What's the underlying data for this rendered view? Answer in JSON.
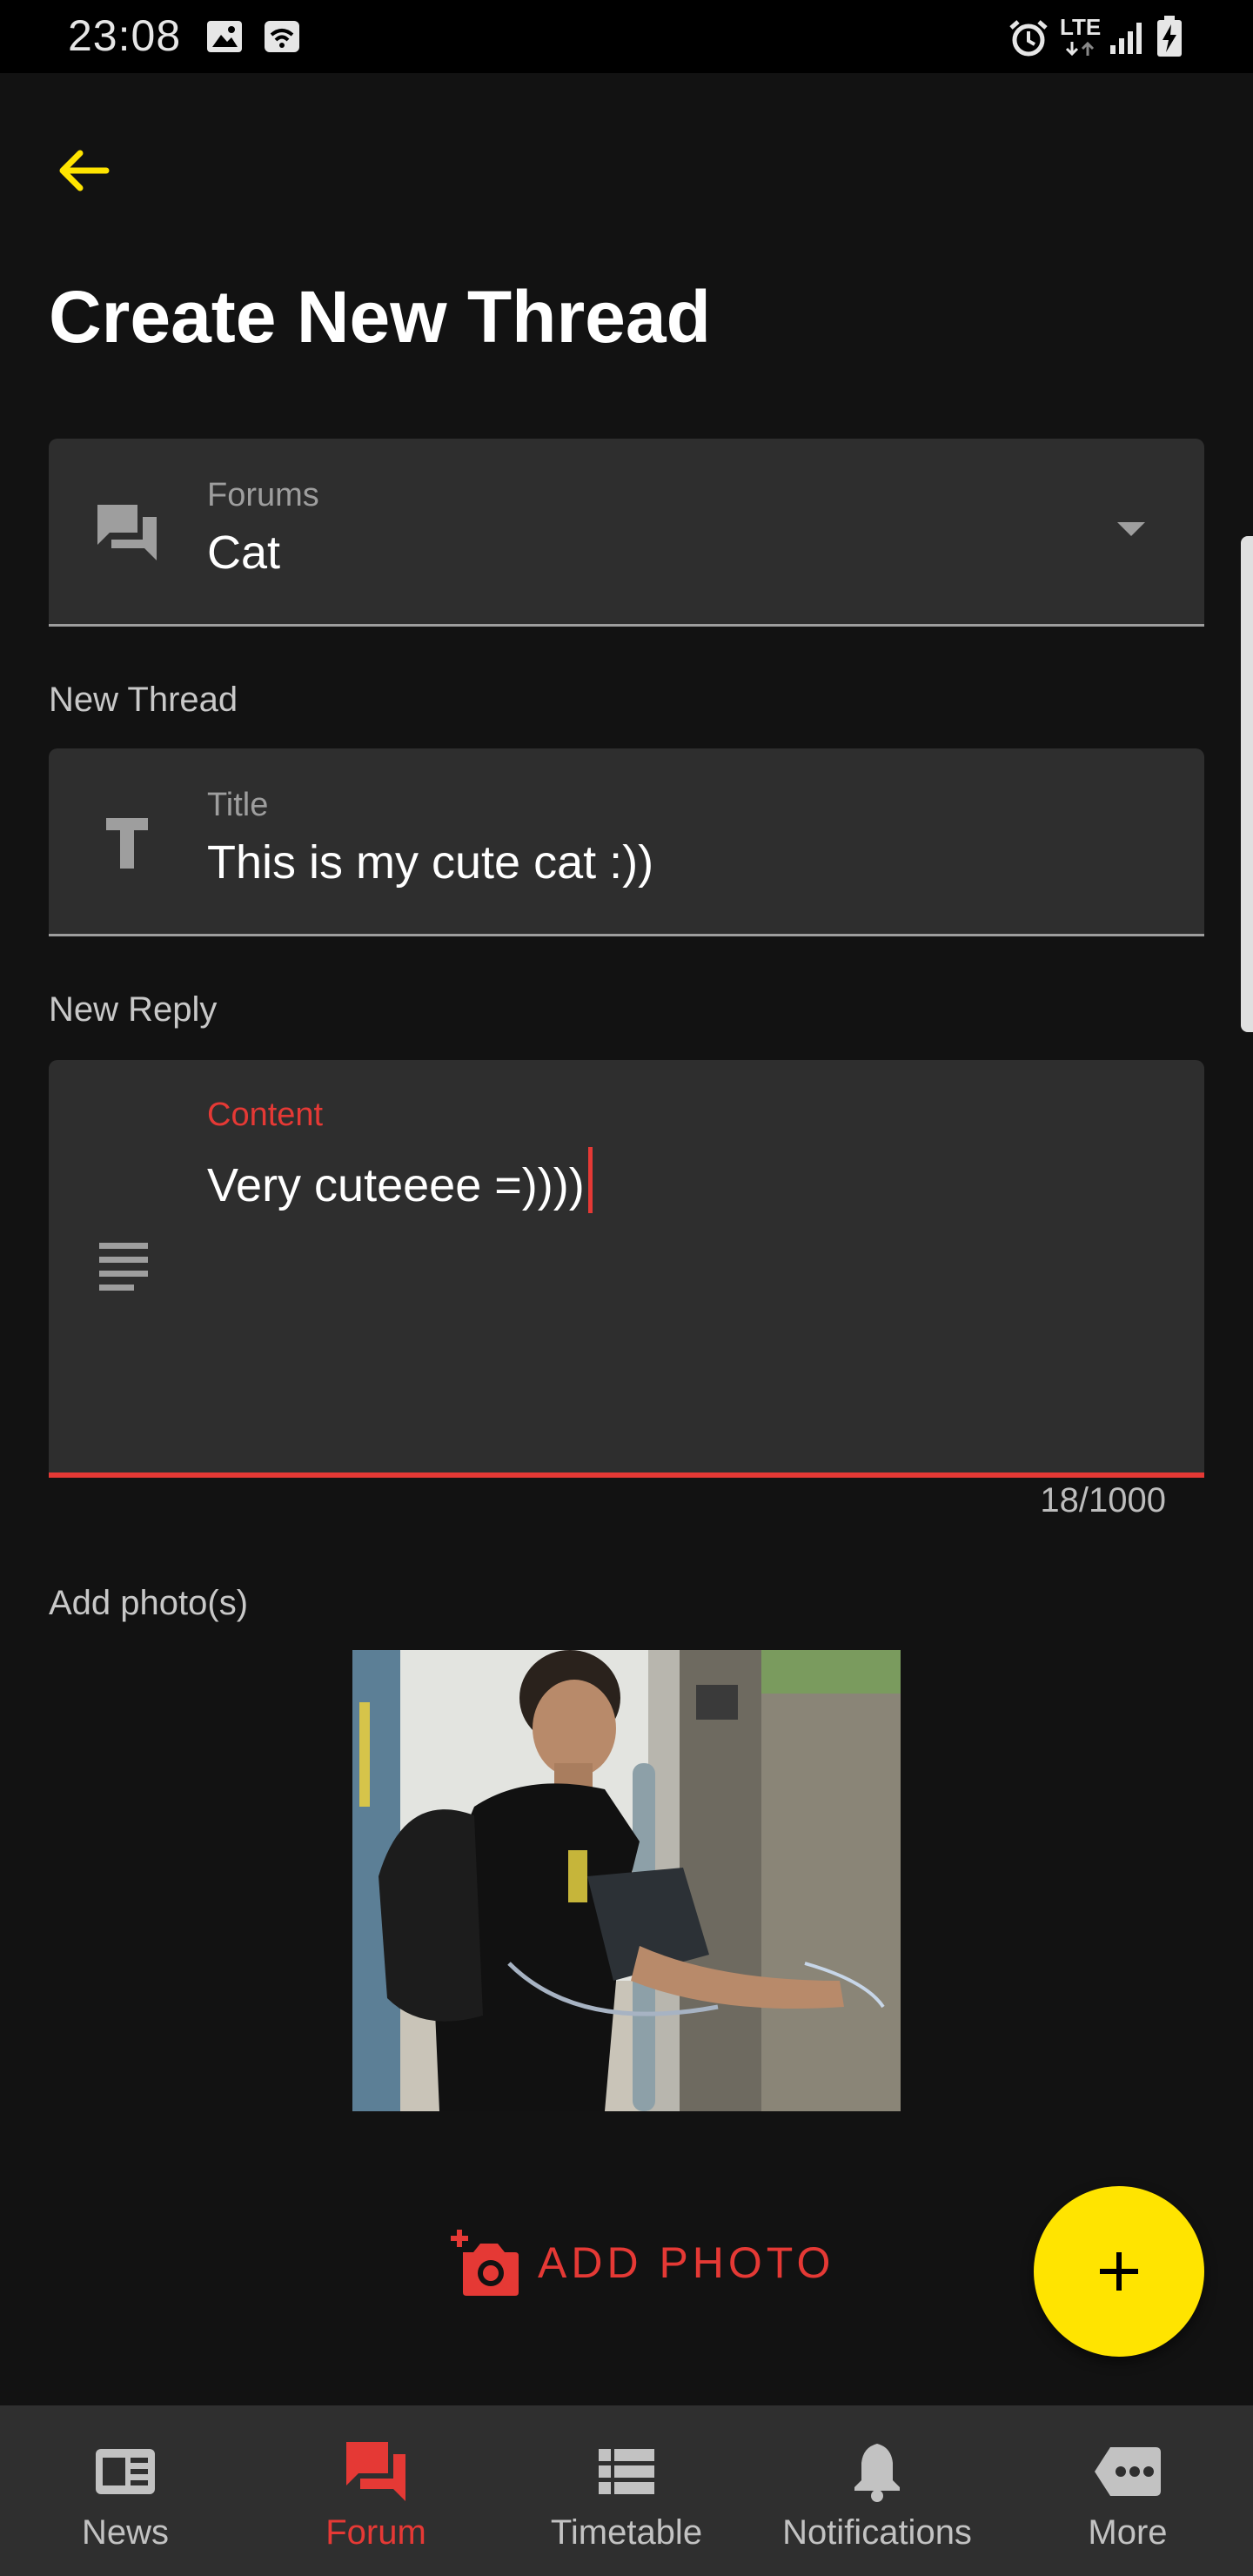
{
  "status_bar": {
    "time": "23:08",
    "network": "LTE",
    "icons": [
      "image-icon",
      "wifi-hotspot-icon",
      "alarm-icon",
      "lte-icon",
      "signal-icon",
      "battery-charging-icon"
    ]
  },
  "header": {
    "back_icon": "arrow-back-icon",
    "title": "Create New Thread"
  },
  "forum_field": {
    "icon": "forum-icon",
    "label": "Forums",
    "value": "Cat",
    "dropdown_icon": "dropdown-arrow-icon"
  },
  "new_thread": {
    "section_label": "New Thread",
    "title_field": {
      "icon": "text-icon",
      "label": "Title",
      "value": "This is my cute cat :))"
    }
  },
  "new_reply": {
    "section_label": "New Reply",
    "content_field": {
      "icon": "subject-icon",
      "label": "Content",
      "value": "Very cuteeee =))))",
      "counter": "18/1000"
    }
  },
  "photos": {
    "section_label": "Add photo(s)",
    "add_button_label": "ADD PHOTO",
    "add_button_icon": "add-a-photo-icon"
  },
  "fab": {
    "icon": "plus-icon"
  },
  "bottom_nav": {
    "items": [
      {
        "label": "News",
        "icon": "news-icon",
        "active": false
      },
      {
        "label": "Forum",
        "icon": "forum-icon",
        "active": true
      },
      {
        "label": "Timetable",
        "icon": "list-icon",
        "active": false
      },
      {
        "label": "Notifications",
        "icon": "bell-icon",
        "active": false
      },
      {
        "label": "More",
        "icon": "more-icon",
        "active": false
      }
    ]
  },
  "colors": {
    "background": "#121212",
    "surface": "#2e2e2e",
    "accent_red": "#e53935",
    "accent_yellow": "#ffe400",
    "muted_text": "#9e9e9e"
  }
}
